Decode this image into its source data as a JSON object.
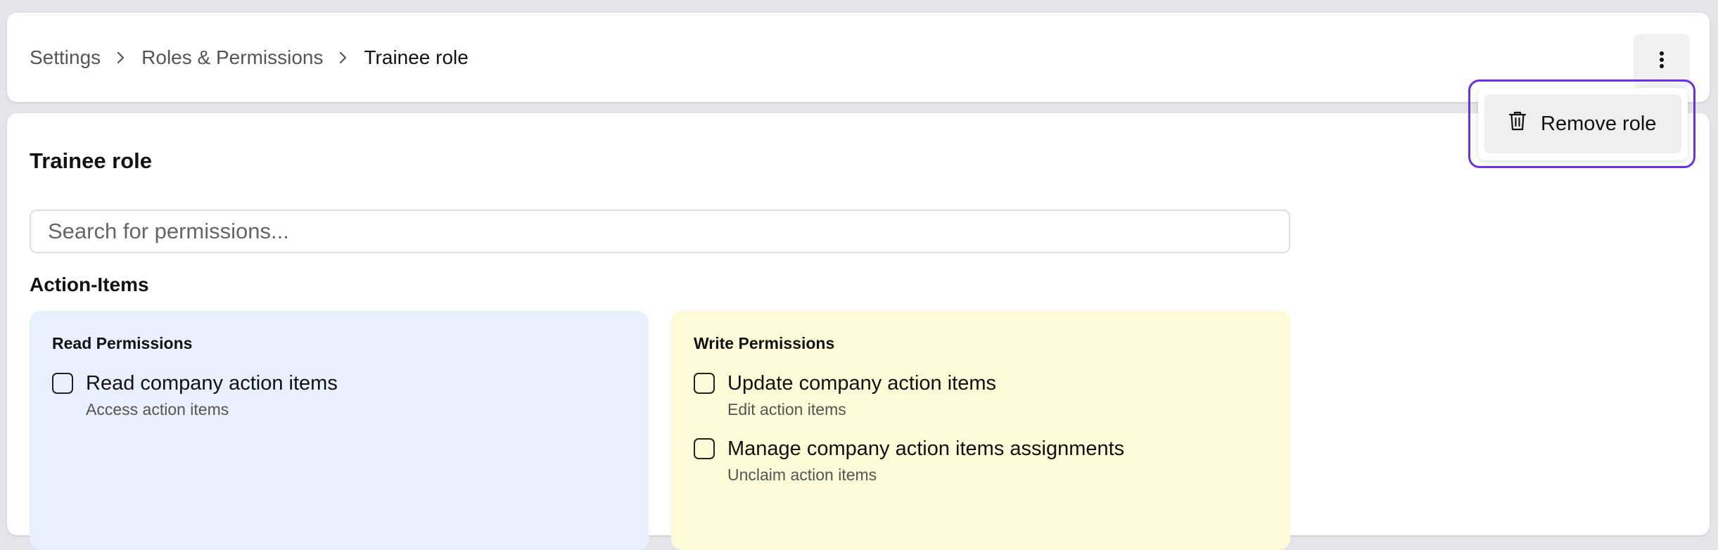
{
  "breadcrumb": {
    "items": [
      "Settings",
      "Roles & Permissions"
    ],
    "current": "Trainee role"
  },
  "page": {
    "title": "Trainee role",
    "search_placeholder": "Search for permissions..."
  },
  "section": {
    "title": "Action-Items",
    "read": {
      "title": "Read Permissions",
      "items": [
        {
          "label": "Read company action items",
          "desc": "Access action items"
        }
      ]
    },
    "write": {
      "title": "Write Permissions",
      "items": [
        {
          "label": "Update company action items",
          "desc": "Edit action items"
        },
        {
          "label": "Manage company action items assignments",
          "desc": "Unclaim action items"
        }
      ]
    }
  },
  "menu": {
    "remove_label": "Remove role"
  },
  "icons": {
    "more": "more-vertical-icon",
    "chevron": "chevron-right-icon",
    "trash": "trash-icon"
  },
  "colors": {
    "accent": "#6d2ee6",
    "read_bg": "#e9effd",
    "write_bg": "#fdfad8"
  }
}
